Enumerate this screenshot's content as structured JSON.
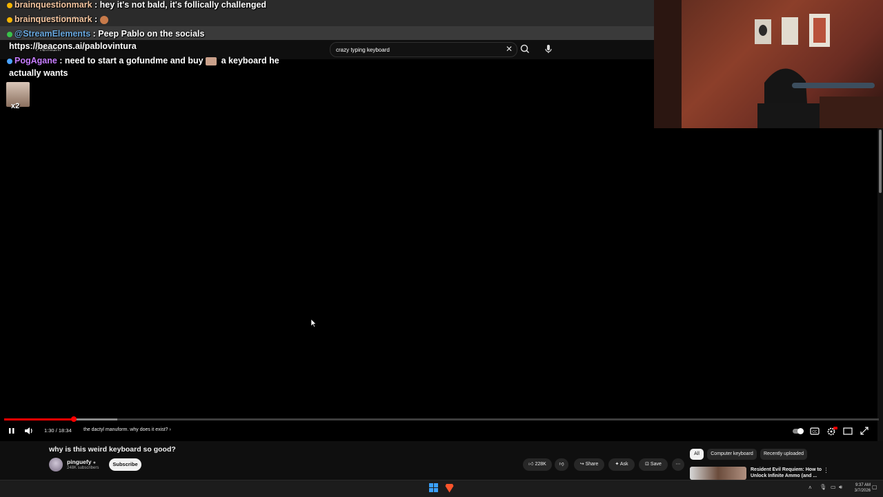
{
  "browser": {
    "url": "watch?v=XScUYxLFt-U",
    "premium_label": "Premium"
  },
  "search": {
    "value": "crazy typing keyboard",
    "placeholder": "Search"
  },
  "chat": [
    {
      "username": "brainquestionmark",
      "message": "hey it's not bald, it's follically challenged"
    },
    {
      "username": "brainquestionmark",
      "message": ""
    },
    {
      "username": "@StreamElements",
      "message": "Peep Pablo on the socials"
    },
    {
      "username": "",
      "message": "https://beacons.ai/pablovintura"
    },
    {
      "username": "PogAgane",
      "message": "need to start a gofundme and buy",
      "message2": "a keyboard he",
      "message3": "actually wants"
    }
  ],
  "emote": {
    "multiplier": "x2"
  },
  "player": {
    "progress": 0.08,
    "time": "1:30 / 18:34",
    "chapter": "the dactyl manuform. why does it exist?"
  },
  "video": {
    "title": "why is this weird keyboard so good?",
    "channel": "pinguefy",
    "subscribers": "248K subscribers",
    "subscribe_label": "Subscribe",
    "likes": "228K",
    "share_label": "Share",
    "ask_label": "Ask",
    "save_label": "Save"
  },
  "chips": [
    "All",
    "Computer keyboard",
    "Recently uploaded"
  ],
  "recommendation": {
    "title_line1": "Resident Evil Requiem: How to",
    "title_line2": "Unlock Infinite Ammo (and ..."
  },
  "taskbar": {
    "time": "9:37 AM",
    "date": "3/7/2026"
  },
  "colors": {
    "accent_red": "#ff0000",
    "subscribe_bg": "#f1f1f1",
    "background": "#0f0f0f"
  }
}
